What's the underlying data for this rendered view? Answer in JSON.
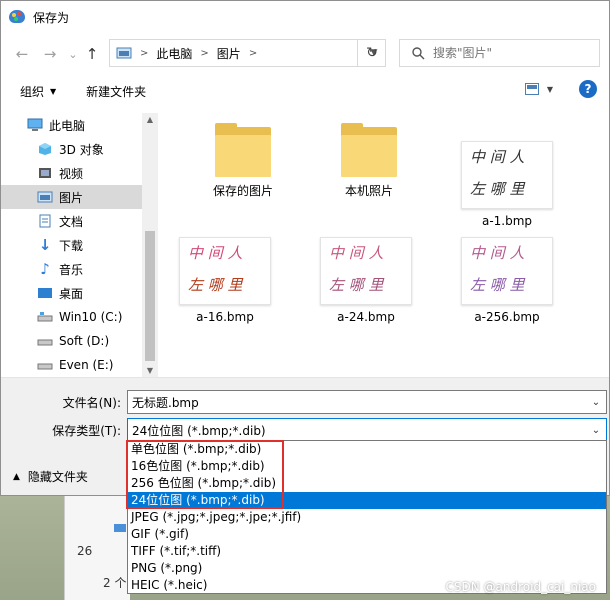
{
  "window": {
    "title": "保存为"
  },
  "nav": {
    "back": "←",
    "forward": "→",
    "recent": "⌄",
    "up": "↑",
    "breadcrumb": [
      "此电脑",
      "图片"
    ],
    "refresh": "↻",
    "search_placeholder": "搜索\"图片\""
  },
  "toolbar": {
    "organize": "组织",
    "new_folder": "新建文件夹",
    "help": "?"
  },
  "sidebar": {
    "items": [
      {
        "label": "此电脑",
        "icon": "computer-icon"
      },
      {
        "label": "3D 对象",
        "icon": "cube-icon"
      },
      {
        "label": "视频",
        "icon": "video-icon"
      },
      {
        "label": "图片",
        "icon": "picture-icon",
        "selected": true
      },
      {
        "label": "文档",
        "icon": "document-icon"
      },
      {
        "label": "下载",
        "icon": "download-icon"
      },
      {
        "label": "音乐",
        "icon": "music-icon"
      },
      {
        "label": "桌面",
        "icon": "desktop-icon"
      },
      {
        "label": "Win10 (C:)",
        "icon": "drive-icon"
      },
      {
        "label": "Soft (D:)",
        "icon": "drive-icon"
      },
      {
        "label": "Even (E:)",
        "icon": "drive-icon"
      }
    ]
  },
  "files": [
    {
      "name": "保存的图片",
      "type": "folder"
    },
    {
      "name": "本机照片",
      "type": "folder"
    },
    {
      "name": "a-1.bmp",
      "type": "image"
    },
    {
      "name": "a-16.bmp",
      "type": "image"
    },
    {
      "name": "a-24.bmp",
      "type": "image"
    },
    {
      "name": "a-256.bmp",
      "type": "image"
    }
  ],
  "handwriting": {
    "line1": "中 间 人",
    "line2": "左 哪 里"
  },
  "form": {
    "filename_label": "文件名(N):",
    "filename_value": "无标题.bmp",
    "filetype_label": "保存类型(T):",
    "filetype_value": "24位位图 (*.bmp;*.dib)",
    "hide_folders": "隐藏文件夹"
  },
  "filetype_options": [
    "单色位图 (*.bmp;*.dib)",
    "16色位图 (*.bmp;*.dib)",
    "256 色位图 (*.bmp;*.dib)",
    "24位位图 (*.bmp;*.dib)",
    "JPEG (*.jpg;*.jpeg;*.jpe;*.jfif)",
    "GIF (*.gif)",
    "TIFF (*.tif;*.tiff)",
    "PNG (*.png)",
    "HEIC (*.heic)"
  ],
  "selected_option_index": 3,
  "background": {
    "text_1": "26",
    "text_2": "2 个"
  },
  "watermark": "CSDN @android_cai_niao",
  "colors": {
    "accent": "#0078d7",
    "highlight_box": "#e0302c",
    "folder": "#f9d977"
  }
}
